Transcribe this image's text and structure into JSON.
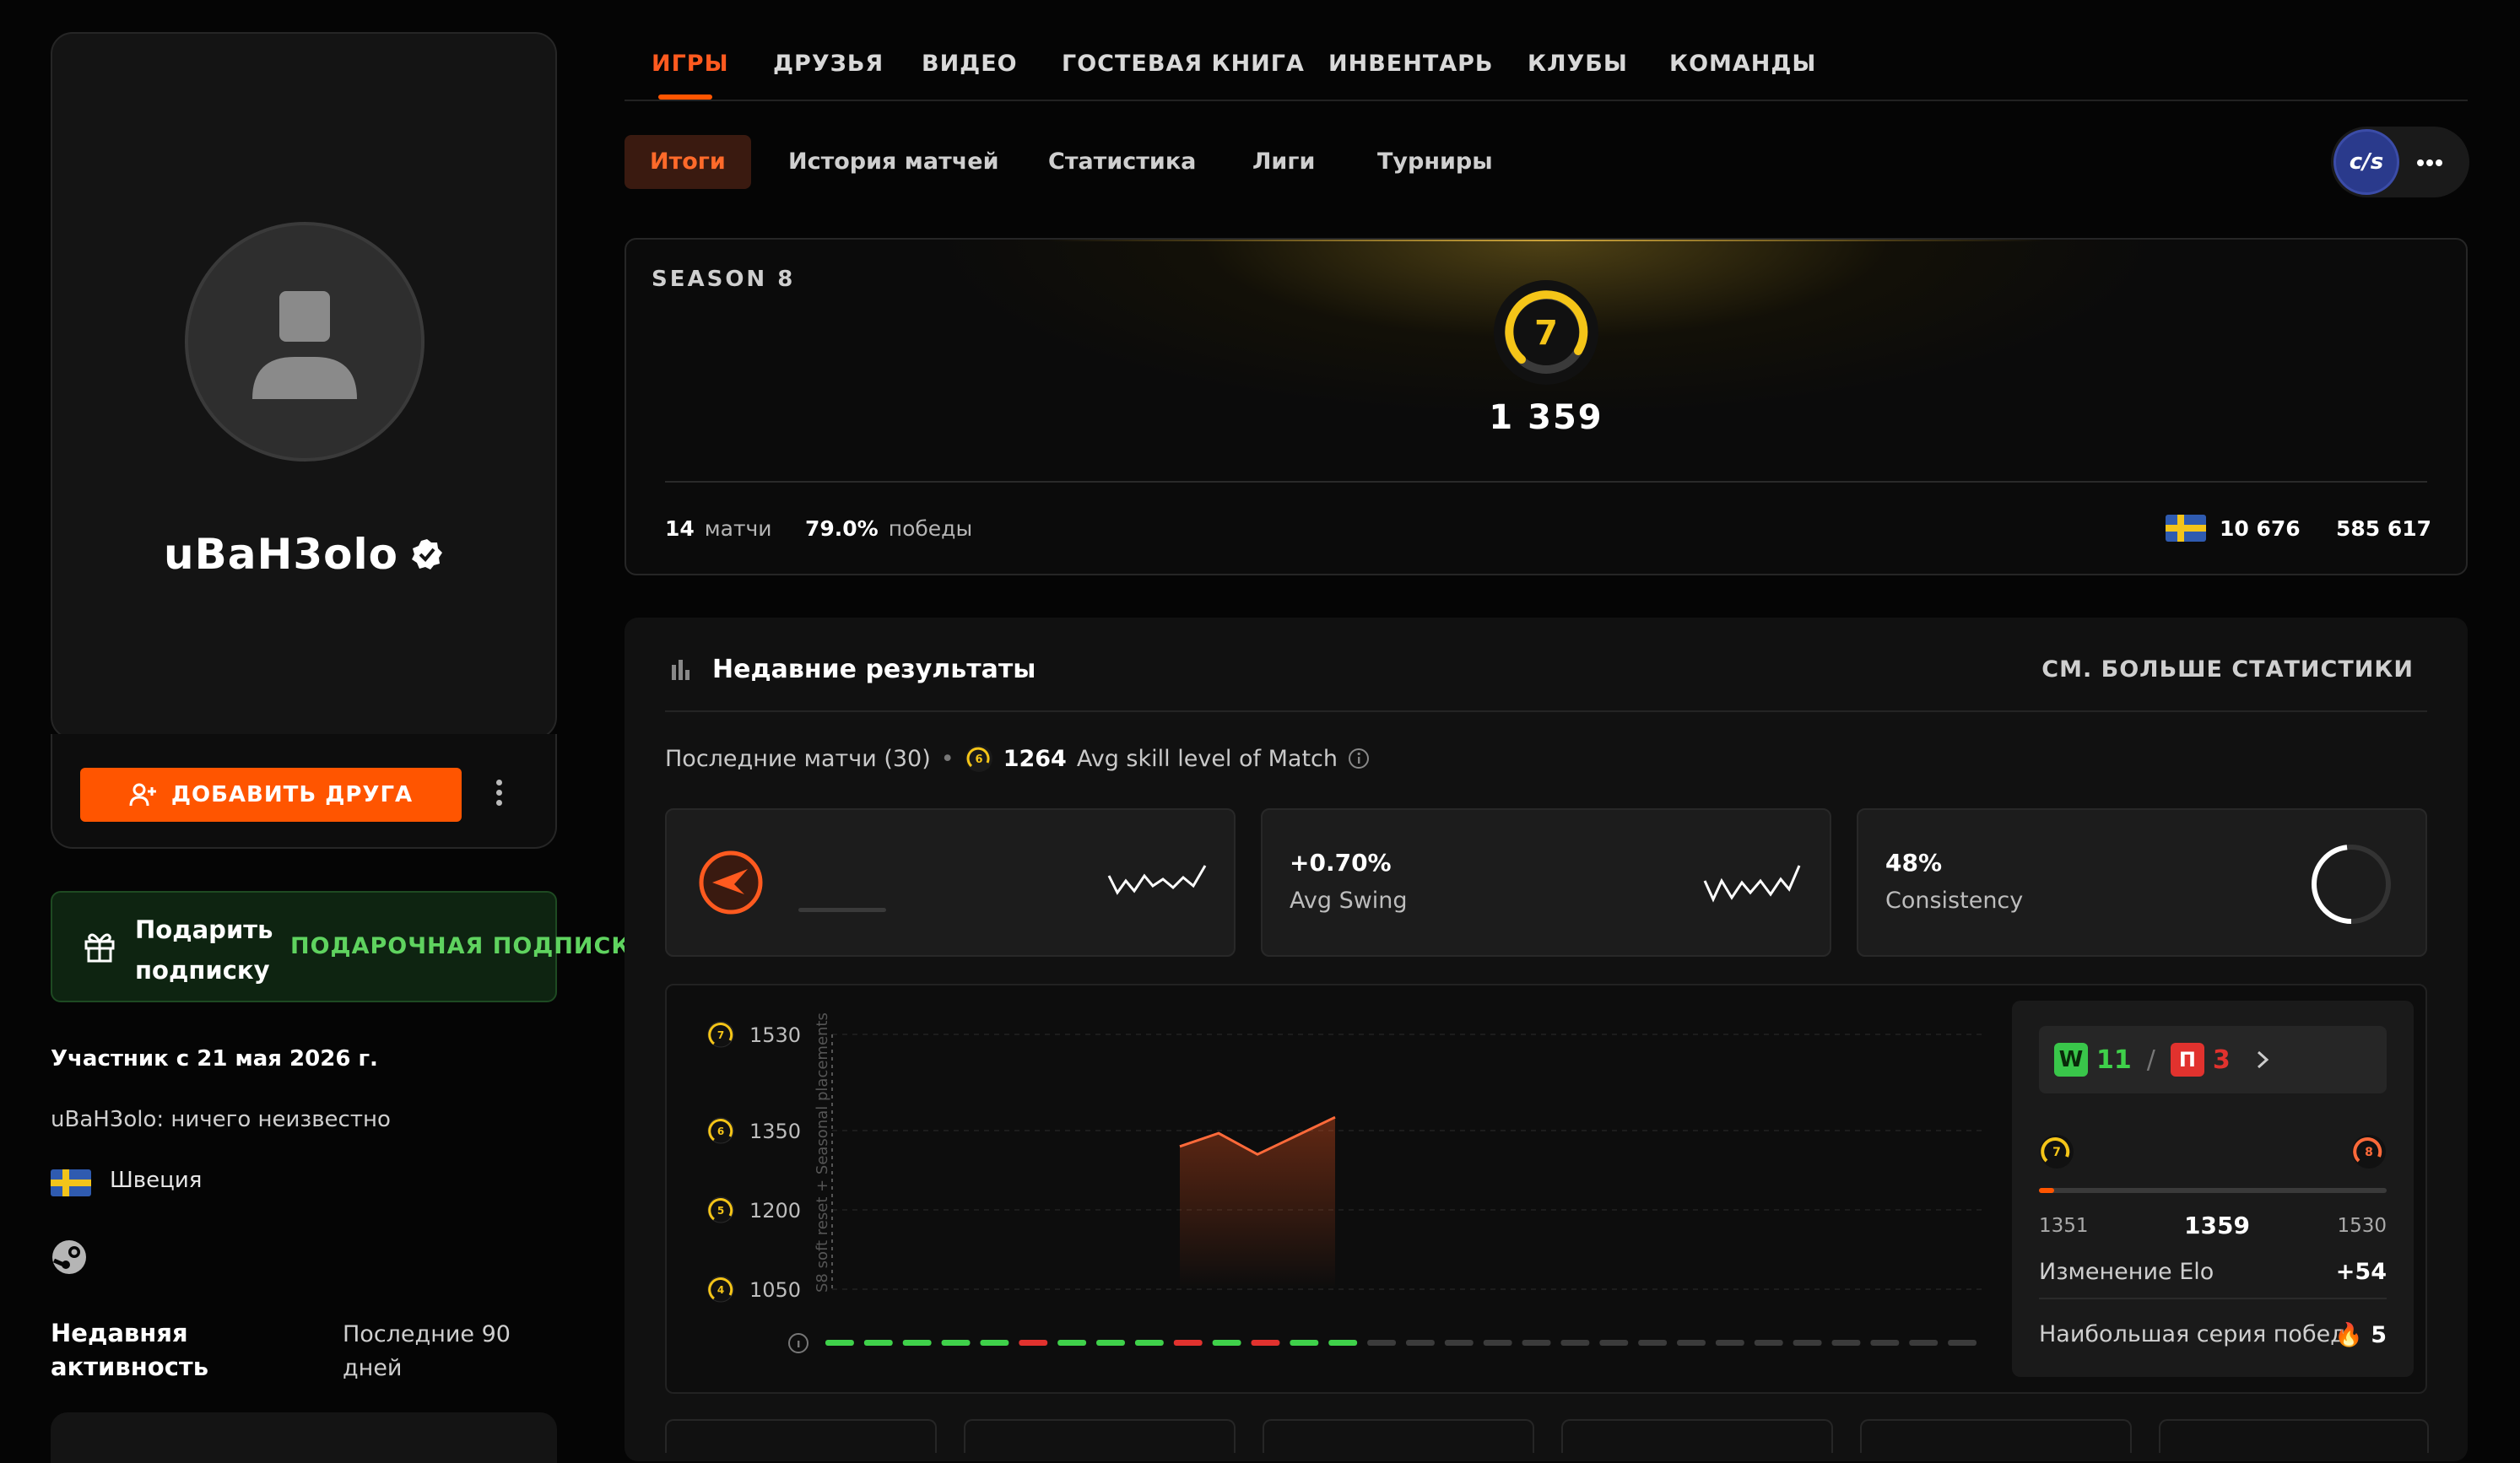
{
  "profile": {
    "username": "uBaH3olo",
    "add_friend": "ДОБАВИТЬ ДРУГА",
    "gift_title": "Подарить подписку",
    "gift_link": "ПОДАРОЧНАЯ ПОДПИСКА",
    "member_since": "Участник с 21 мая 2026 г.",
    "bio": "uBaH3olo: ничего неизвестно",
    "country": "Швеция",
    "activity_label": "Недавняя активность",
    "activity_value": "Последние 90 дней"
  },
  "main_tabs": [
    {
      "label": "ИГРЫ",
      "active": true
    },
    {
      "label": "ДРУЗЬЯ"
    },
    {
      "label": "ВИДЕО"
    },
    {
      "label": "ГОСТЕВАЯ КНИГА"
    },
    {
      "label": "ИНВЕНТАРЬ"
    },
    {
      "label": "КЛУБЫ"
    },
    {
      "label": "КОМАНДЫ"
    }
  ],
  "sub_tabs": [
    {
      "label": "Итоги",
      "active": true
    },
    {
      "label": "История матчей"
    },
    {
      "label": "Статистика"
    },
    {
      "label": "Лиги"
    },
    {
      "label": "Турниры"
    }
  ],
  "game_logo": "c/s",
  "season": {
    "label": "SEASON 8",
    "level": "7",
    "elo": "1 359",
    "matches_value": "14",
    "matches_label": "матчи",
    "winrate_value": "79.0%",
    "winrate_label": "победы",
    "country_rank": "10 676",
    "global_rank": "585 617"
  },
  "results": {
    "title": "Недавние результаты",
    "more_link": "СМ. БОЛЬШЕ СТАТИСТИКИ",
    "last_matches": "Последние матчи (30)",
    "avg_level_badge": "6",
    "avg_skill_value": "1264",
    "avg_skill_label": "Avg skill level of Match",
    "stats": [
      {
        "value": "",
        "label": ""
      },
      {
        "value": "+0.70%",
        "label": "Avg Swing"
      },
      {
        "value": "48%",
        "label": "Consistency"
      }
    ]
  },
  "chart_data": {
    "type": "line",
    "y_ticks": [
      {
        "level": "7",
        "value": 1530
      },
      {
        "level": "6",
        "value": 1350
      },
      {
        "level": "5",
        "value": 1200
      },
      {
        "level": "4",
        "value": 1050
      }
    ],
    "marker_label": "S8 soft reset + Seasonal placements",
    "series": [
      {
        "values": [
          1320,
          1345,
          1305,
          1340,
          1375
        ]
      }
    ],
    "ylim": [
      1050,
      1530
    ],
    "results": [
      "W",
      "W",
      "W",
      "W",
      "W",
      "L",
      "W",
      "W",
      "W",
      "L",
      "W",
      "L",
      "W",
      "W",
      "-",
      "-",
      "-",
      "-",
      "-",
      "-",
      "-",
      "-",
      "-",
      "-",
      "-",
      "-",
      "-",
      "-",
      "-",
      "-"
    ],
    "colors": {
      "win": "#3fd14a",
      "loss": "#e1322e",
      "none": "#3b3b3b",
      "line": "#ff6a3a"
    }
  },
  "summary": {
    "wins": "11",
    "losses": "3",
    "win_badge": "W",
    "loss_badge": "П",
    "level_from": "7",
    "level_to": "8",
    "range_min": "1351",
    "range_current": "1359",
    "range_max": "1530",
    "elo_change_label": "Изменение Elo",
    "elo_change_value": "+54",
    "streak_label": "Наибольшая серия побед",
    "streak_value": "5"
  }
}
